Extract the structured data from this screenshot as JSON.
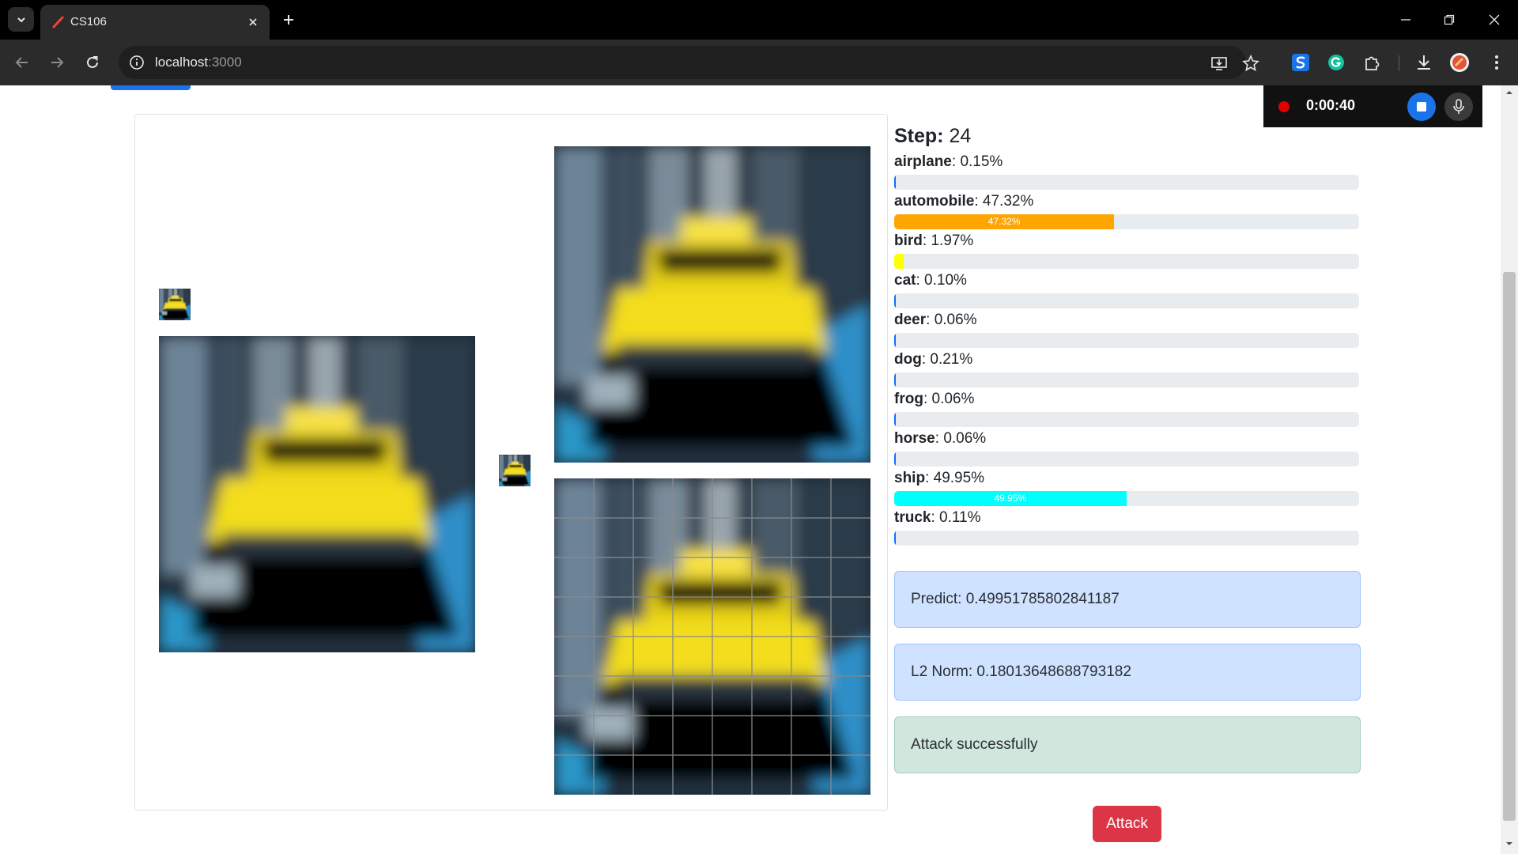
{
  "browser": {
    "tab_title": "CS106",
    "url_host": "localhost",
    "url_port": ":3000"
  },
  "recorder": {
    "time": "0:00:40"
  },
  "step": {
    "label": "Step:",
    "value": "24"
  },
  "classes": [
    {
      "name": "airplane",
      "percent": "0.15%",
      "value": 0.15,
      "color": "#0d6efd",
      "show_label": false
    },
    {
      "name": "automobile",
      "percent": "47.32%",
      "value": 47.32,
      "color": "#ffa500",
      "show_label": true
    },
    {
      "name": "bird",
      "percent": "1.97%",
      "value": 1.97,
      "color": "#ffff00",
      "show_label": false
    },
    {
      "name": "cat",
      "percent": "0.10%",
      "value": 0.1,
      "color": "#0d6efd",
      "show_label": false
    },
    {
      "name": "deer",
      "percent": "0.06%",
      "value": 0.06,
      "color": "#0d6efd",
      "show_label": false
    },
    {
      "name": "dog",
      "percent": "0.21%",
      "value": 0.21,
      "color": "#0d6efd",
      "show_label": false
    },
    {
      "name": "frog",
      "percent": "0.06%",
      "value": 0.06,
      "color": "#0d6efd",
      "show_label": false
    },
    {
      "name": "horse",
      "percent": "0.06%",
      "value": 0.06,
      "color": "#0d6efd",
      "show_label": false
    },
    {
      "name": "ship",
      "percent": "49.95%",
      "value": 49.95,
      "color": "#00ffff",
      "show_label": true
    },
    {
      "name": "truck",
      "percent": "0.11%",
      "value": 0.11,
      "color": "#0d6efd",
      "show_label": false
    }
  ],
  "alerts": {
    "predict": "Predict: 0.49951785802841187",
    "l2_norm": "L2 Norm: 0.18013648688793182",
    "status": "Attack successfully"
  },
  "actions": {
    "attack_label": "Attack"
  },
  "colors": {
    "attack_button": "#dc3545",
    "info_alert": "#cfe2ff",
    "success_alert": "#d1e7dd"
  }
}
